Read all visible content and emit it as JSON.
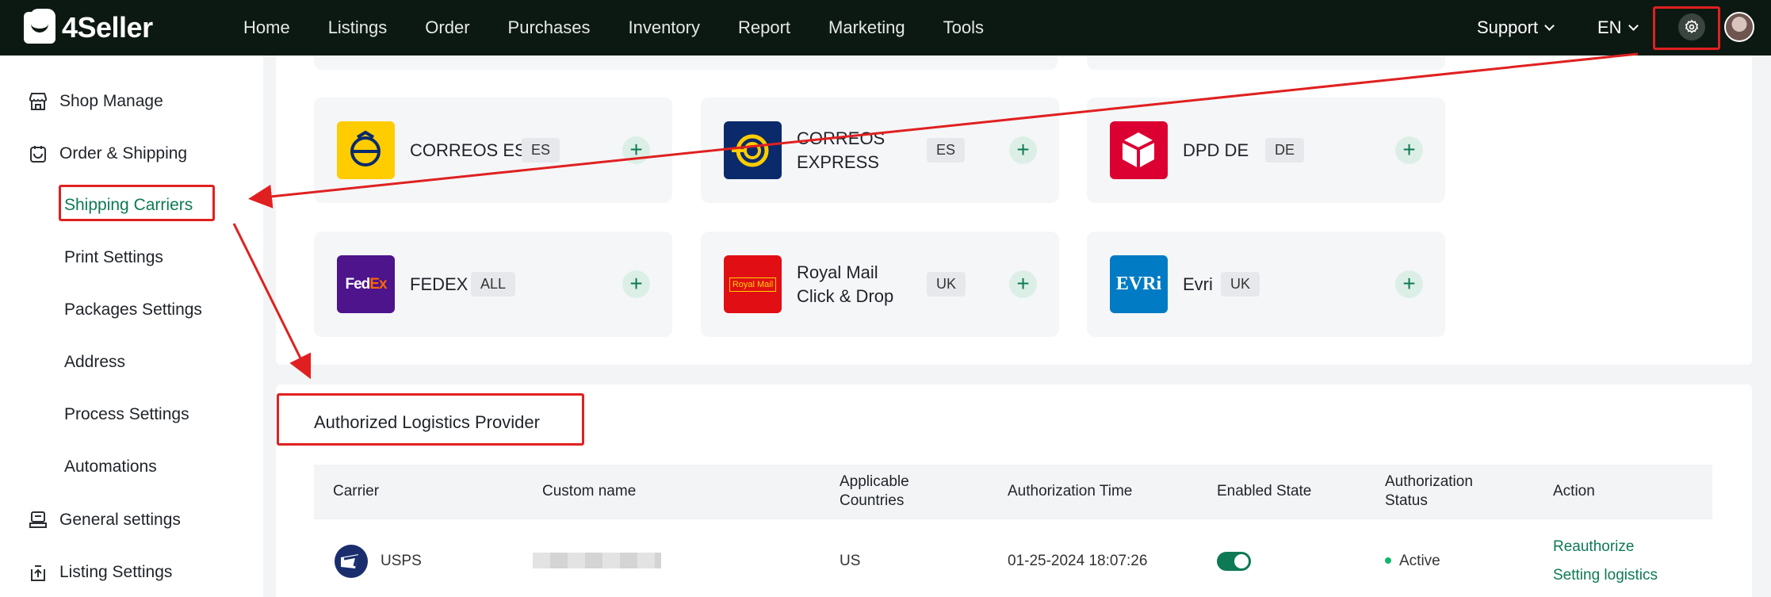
{
  "brand": {
    "name": "4Seller"
  },
  "nav": {
    "items": [
      "Home",
      "Listings",
      "Order",
      "Purchases",
      "Inventory",
      "Report",
      "Marketing",
      "Tools"
    ]
  },
  "header": {
    "support": "Support",
    "language": "EN"
  },
  "sidebar": {
    "groups": [
      {
        "label": "Shop Manage",
        "icon": "shop-icon"
      },
      {
        "label": "Order & Shipping",
        "icon": "order-icon"
      },
      {
        "label": "General settings",
        "icon": "general-settings-icon"
      },
      {
        "label": "Listing Settings",
        "icon": "listing-settings-icon"
      }
    ],
    "subitems": [
      "Shipping Carriers",
      "Print Settings",
      "Packages Settings",
      "Address",
      "Process Settings",
      "Automations"
    ],
    "active": "Shipping Carriers"
  },
  "carriers": [
    {
      "name": "CORREOS ES",
      "region": "ES",
      "color": "#ffcc00"
    },
    {
      "name": "CORREOS EXPRESS",
      "line1": "CORREOS",
      "line2": "EXPRESS",
      "region": "ES",
      "color": "#0a2a6b"
    },
    {
      "name": "DPD DE",
      "region": "DE",
      "color": "#dc0032"
    },
    {
      "name": "FEDEX",
      "region": "ALL",
      "color": "#4d148c",
      "logo_fed": "Fed",
      "logo_ex": "Ex"
    },
    {
      "name": "Royal Mail Click & Drop",
      "line1": "Royal Mail",
      "line2": "Click & Drop",
      "region": "UK",
      "color": "#e10f14",
      "logo_text": "Royal Mail"
    },
    {
      "name": "Evri",
      "region": "UK",
      "color": "#007bc4",
      "logo_text": "EVRi"
    }
  ],
  "authorized": {
    "title": "Authorized Logistics Provider",
    "columns": {
      "carrier": "Carrier",
      "custom_name": "Custom name",
      "countries_1": "Applicable",
      "countries_2": "Countries",
      "auth_time": "Authorization Time",
      "enabled": "Enabled State",
      "status_1": "Authorization",
      "status_2": "Status",
      "action": "Action"
    },
    "rows": [
      {
        "carrier": "USPS",
        "countries": "US",
        "auth_time": "01-25-2024 18:07:26",
        "enabled": true,
        "status": "Active",
        "action_1": "Reauthorize",
        "action_2": "Setting logistics"
      }
    ]
  },
  "colors": {
    "accent": "#0d7a55",
    "topbar": "#0c1912",
    "annotation": "#e02020"
  }
}
